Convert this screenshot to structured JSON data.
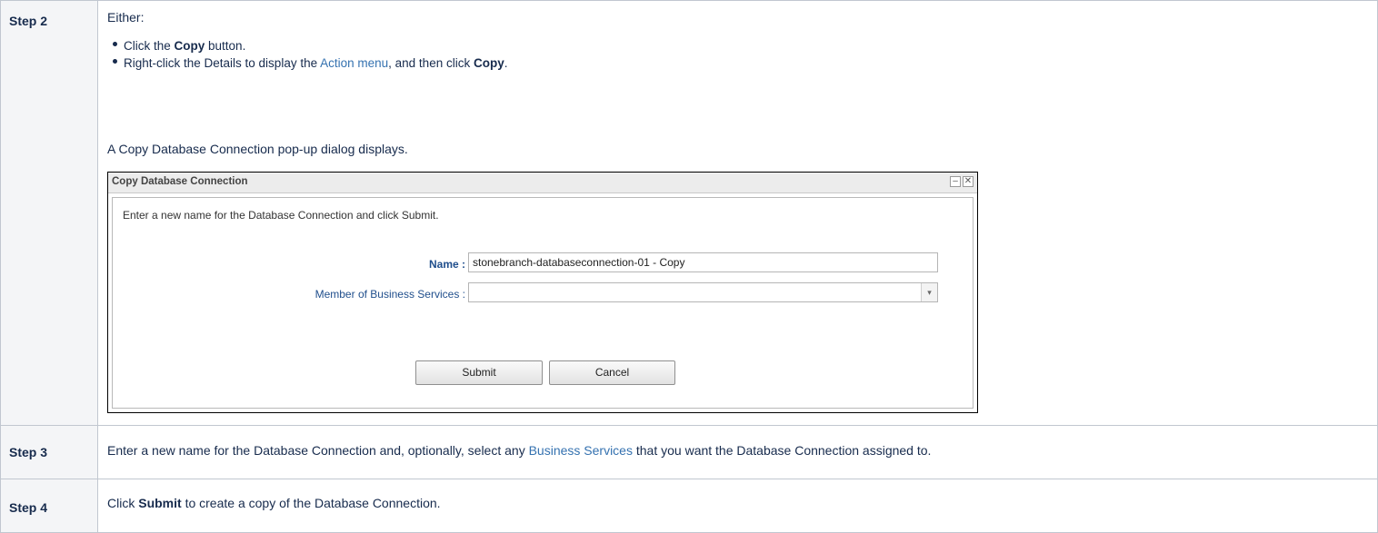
{
  "steps": [
    {
      "label": "Step 2",
      "intro": "Either:",
      "bullet1": {
        "pre": "Click the ",
        "bold": "Copy",
        "post": " button."
      },
      "bullet2": {
        "pre": "Right-click the Details to display the ",
        "link": "Action menu",
        "mid": ", and then click ",
        "bold": "Copy",
        "post": "."
      },
      "result": "A Copy Database Connection pop-up dialog displays."
    },
    {
      "label": "Step 3",
      "pre": "Enter a new name for the Database Connection and, optionally, select any ",
      "link": "Business Services",
      "post": " that you want the Database Connection assigned to."
    },
    {
      "label": "Step 4",
      "bold": "Submit",
      "post": " to create a copy of the Database Connection.",
      "pre": "Click "
    }
  ],
  "dialog": {
    "title": "Copy Database Connection",
    "minimize_glyph": "–",
    "close_glyph": "✕",
    "intro": "Enter a new name for the Database Connection and click Submit.",
    "name_label": "Name :",
    "name_value": "stonebranch-databaseconnection-01 - Copy",
    "member_label": "Member of Business Services :",
    "member_value": "",
    "dropdown_glyph": "▾",
    "submit_label": "Submit",
    "cancel_label": "Cancel"
  },
  "colors": {
    "link": "#3572b0",
    "header_bg": "#f4f5f7",
    "border": "#c1c7d0",
    "label_blue": "#1f4e8c"
  }
}
